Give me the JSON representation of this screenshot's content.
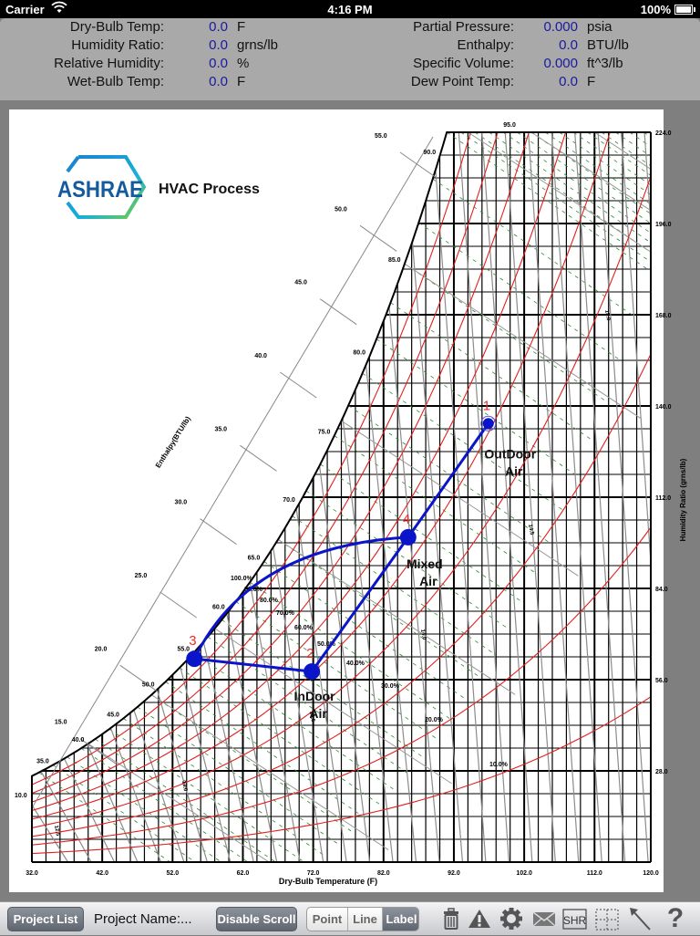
{
  "status_bar": {
    "carrier": "Carrier",
    "time": "4:16 PM",
    "battery": "100%",
    "battery_level": 1.0
  },
  "readout": {
    "left": [
      {
        "label": "Dry-Bulb Temp:",
        "value": "0.0",
        "unit": "F"
      },
      {
        "label": "Humidity Ratio:",
        "value": "0.0",
        "unit": "grns/lb"
      },
      {
        "label": "Relative Humidity:",
        "value": "0.0",
        "unit": "%"
      },
      {
        "label": "Wet-Bulb Temp:",
        "value": "0.0",
        "unit": "F"
      }
    ],
    "right": [
      {
        "label": "Partial Pressure:",
        "value": "0.000",
        "unit": "psia"
      },
      {
        "label": "Enthalpy:",
        "value": "0.0",
        "unit": "BTU/lb"
      },
      {
        "label": "Specific Volume:",
        "value": "0.000",
        "unit": "ft^3/lb"
      },
      {
        "label": "Dew Point Temp:",
        "value": "0.0",
        "unit": "F"
      }
    ]
  },
  "logo": {
    "text": "ASHRAE",
    "title": "HVAC Process"
  },
  "chart_data": {
    "type": "scatter",
    "title": "HVAC Process",
    "xlabel": "Dry-Bulb Temperature (F)",
    "ylabel": "Humidity Ratio (grns/lb)",
    "enthalpy_label": "Enthalpy(BTU/lb)",
    "xlim": [
      32,
      120
    ],
    "ylim": [
      0,
      224
    ],
    "x_ticks": [
      "32.0",
      "42.0",
      "52.0",
      "62.0",
      "72.0",
      "82.0",
      "92.0",
      "102.0",
      "112.0",
      "120.0"
    ],
    "y_ticks": [
      "28.0",
      "56.0",
      "84.0",
      "112.0",
      "140.0",
      "168.0",
      "196.0",
      "224.0"
    ],
    "enthalpy_ticks": [
      "10.0",
      "15.0",
      "20.0",
      "25.0",
      "30.0",
      "35.0",
      "40.0",
      "45.0",
      "50.0",
      "55.0"
    ],
    "saturation_labels": [
      "35.0",
      "40.0",
      "45.0",
      "50.0",
      "55.0",
      "60.0",
      "65.0",
      "70.0",
      "75.0",
      "80.0",
      "85.0",
      "90.0",
      "95.0"
    ],
    "rh_labels": [
      "100.0%",
      "90.0%",
      "80.0%",
      "70.0%",
      "60.0%",
      "50.0%",
      "40.0%",
      "30.0%",
      "20.0%",
      "10.0%"
    ],
    "rh_curves": [
      1.0,
      0.9,
      0.8,
      0.7,
      0.6,
      0.5,
      0.4,
      0.3,
      0.2,
      0.1
    ],
    "volume_labels": [
      "12.5",
      "13.0",
      "13.5",
      "14.0",
      "14.5",
      "15.0"
    ],
    "grid": true,
    "process_points": [
      {
        "id": "1",
        "label": "OutDoor Air",
        "t": 96.9,
        "w": 134.6
      },
      {
        "id": "2",
        "label": "InDoor Air",
        "t": 71.8,
        "w": 58.5
      },
      {
        "id": "3",
        "label": "",
        "t": 55.1,
        "w": 62.4
      },
      {
        "id": "4",
        "label": "Mixed Air",
        "t": 85.5,
        "w": 99.7
      }
    ],
    "process_lines": [
      {
        "from": "1",
        "to": "4",
        "shape": "straight"
      },
      {
        "from": "4",
        "to": "2",
        "shape": "straight"
      },
      {
        "from": "2",
        "to": "3",
        "shape": "straight"
      },
      {
        "from": "3",
        "to": "4",
        "shape": "curve"
      }
    ],
    "colors": {
      "process": "#0a14c8",
      "rh": "#e0201e",
      "point_number": "#ee2b2b",
      "grid": "#000000",
      "wetbulb": "#2e8b2e",
      "volume": "#8c8c8c"
    }
  },
  "toolbar": {
    "project_list": "Project List",
    "project_name": "Project Name:...",
    "disable_scroll": "Disable Scroll",
    "modes": [
      "Point",
      "Line",
      "Label"
    ],
    "active_mode": "Label",
    "shr": "SHR",
    "help": "?"
  }
}
